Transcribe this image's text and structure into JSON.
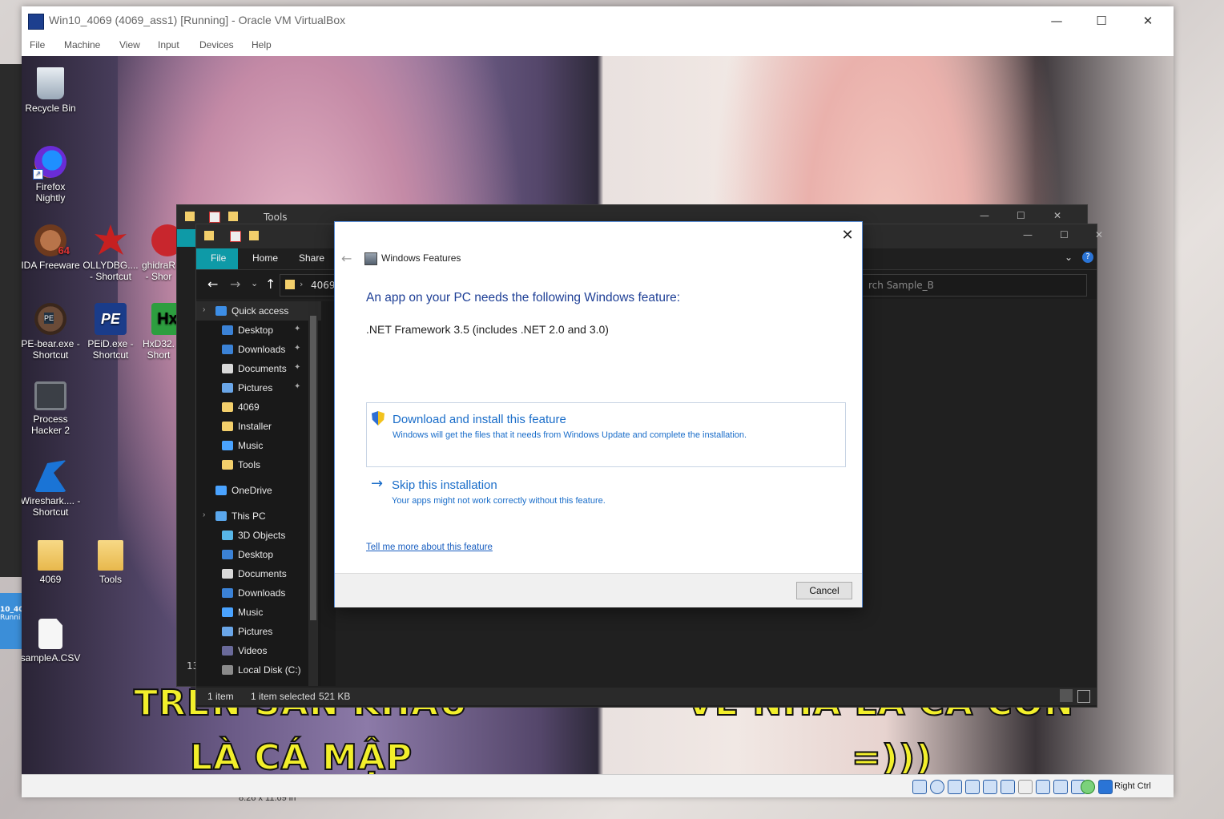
{
  "vbox": {
    "title": "Win10_4069 (4069_ass1) [Running] - Oracle VM VirtualBox",
    "menu": [
      "File",
      "Machine",
      "View",
      "Input",
      "Devices",
      "Help"
    ],
    "status_right": "Right Ctrl"
  },
  "host": {
    "tile_text": "10_40",
    "tile_sub": "Runni",
    "bottom_text": "8.26 x 11.69 in"
  },
  "desktop": {
    "icons": [
      {
        "label": "Recycle Bin",
        "icon": "recycle-bin-icon"
      },
      {
        "label": "Firefox Nightly",
        "icon": "firefox-icon"
      },
      {
        "label": "IDA Freeware",
        "icon": "ida-icon",
        "badge": "64"
      },
      {
        "label": "OLLYDBG.... - Shortcut",
        "icon": "ollydbg-icon"
      },
      {
        "label": "ghidraR - Shor",
        "icon": "ghidra-icon"
      },
      {
        "label": "PE-bear.exe - Shortcut",
        "icon": "pe-bear-icon",
        "badge": "PE"
      },
      {
        "label": "PEiD.exe - Shortcut",
        "icon": "peid-icon",
        "badge": "PE"
      },
      {
        "label": "HxD32. Short",
        "icon": "hxd-icon",
        "badge": "Hx"
      },
      {
        "label": "Process Hacker 2",
        "icon": "process-hacker-icon"
      },
      {
        "label": "Wireshark.... - Shortcut",
        "icon": "wireshark-icon"
      },
      {
        "label": "4069",
        "icon": "folder-icon"
      },
      {
        "label": "Tools",
        "icon": "folder-icon"
      },
      {
        "label": "sampleA.CSV",
        "icon": "file-icon"
      }
    ],
    "captions": [
      "TRÊN SÂN KHẤU",
      "LÀ CÁ MẬP",
      "VỀ NHÀ LÀ CÁ CON",
      "=)))"
    ]
  },
  "explorer_back": {
    "title": "Tools",
    "status": "13"
  },
  "explorer_front": {
    "ribbon_tabs": [
      "File",
      "Home",
      "Share"
    ],
    "address": "4069",
    "search_placeholder": "rch Sample_B",
    "nav": [
      {
        "label": "Quick access",
        "icon": "star-icon",
        "pinned": false
      },
      {
        "label": "Desktop",
        "icon": "desktop-icon",
        "pinned": true
      },
      {
        "label": "Downloads",
        "icon": "download-icon",
        "pinned": true
      },
      {
        "label": "Documents",
        "icon": "documents-icon",
        "pinned": true
      },
      {
        "label": "Pictures",
        "icon": "pictures-icon",
        "pinned": true
      },
      {
        "label": "4069",
        "icon": "folder-icon",
        "pinned": false
      },
      {
        "label": "Installer",
        "icon": "folder-icon",
        "pinned": false
      },
      {
        "label": "Music",
        "icon": "music-icon",
        "pinned": false
      },
      {
        "label": "Tools",
        "icon": "folder-icon",
        "pinned": false
      },
      {
        "label": "OneDrive",
        "icon": "cloud-icon",
        "pinned": false
      },
      {
        "label": "This PC",
        "icon": "computer-icon",
        "pinned": false
      },
      {
        "label": "3D Objects",
        "icon": "cube-icon",
        "pinned": false
      },
      {
        "label": "Desktop",
        "icon": "desktop-icon",
        "pinned": false
      },
      {
        "label": "Documents",
        "icon": "documents-icon",
        "pinned": false
      },
      {
        "label": "Downloads",
        "icon": "download-icon",
        "pinned": false
      },
      {
        "label": "Music",
        "icon": "music-icon",
        "pinned": false
      },
      {
        "label": "Pictures",
        "icon": "pictures-icon",
        "pinned": false
      },
      {
        "label": "Videos",
        "icon": "videos-icon",
        "pinned": false
      },
      {
        "label": "Local Disk (C:)",
        "icon": "disk-icon",
        "pinned": false
      }
    ],
    "status": {
      "items": "1 item",
      "selected": "1 item selected",
      "size": "521 KB"
    }
  },
  "dialog": {
    "app_title": "Windows Features",
    "heading": "An app on your PC needs the following Windows feature:",
    "feature": ".NET Framework 3.5 (includes .NET 2.0 and 3.0)",
    "option_download": {
      "title": "Download and install this feature",
      "desc": "Windows will get the files that it needs from Windows Update and complete the installation."
    },
    "option_skip": {
      "title": "Skip this installation",
      "desc": "Your apps might not work correctly without this feature."
    },
    "link": "Tell me more about this feature",
    "cancel": "Cancel"
  },
  "colors": {
    "dialog_accent": "#1a6dc9",
    "heading": "#1e3f96",
    "ribbon_file_tab": "#0e9aa7",
    "caption_yellow": "#f2ef2b"
  }
}
